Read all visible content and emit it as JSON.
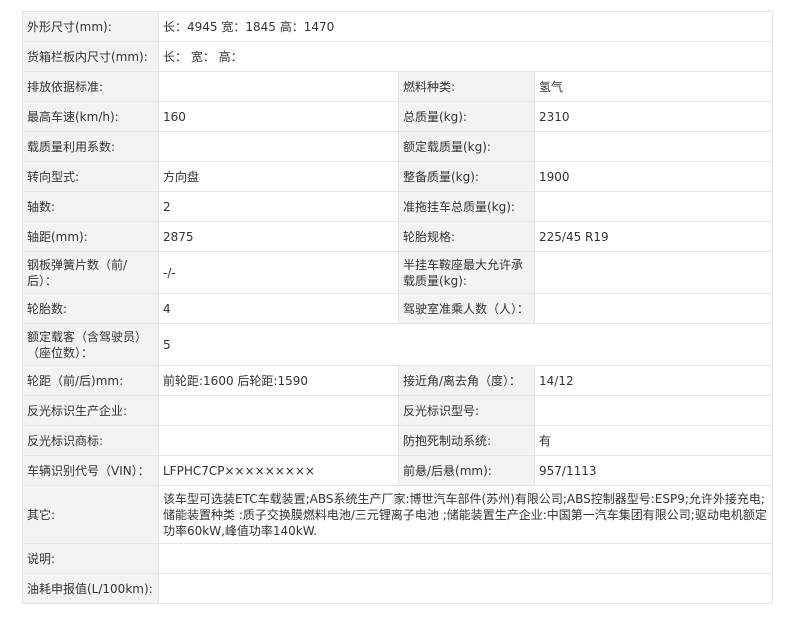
{
  "rows": [
    {
      "l1": "外形尺寸(mm):",
      "v1": "长：4945 宽：1845 高：1470"
    },
    {
      "l1": "货箱栏板内尺寸(mm):",
      "v1": "长： 宽： 高："
    },
    {
      "l1": "排放依据标准:",
      "v1": "",
      "l2": "燃料种类:",
      "v2": "氢气"
    },
    {
      "l1": "最高车速(km/h):",
      "v1": "160",
      "l2": "总质量(kg):",
      "v2": "2310"
    },
    {
      "l1": "载质量利用系数:",
      "v1": "",
      "l2": "额定载质量(kg):",
      "v2": ""
    },
    {
      "l1": "转向型式:",
      "v1": "方向盘",
      "l2": "整备质量(kg):",
      "v2": "1900"
    },
    {
      "l1": "轴数:",
      "v1": "2",
      "l2": "准拖挂车总质量(kg):",
      "v2": ""
    },
    {
      "l1": "轴距(mm):",
      "v1": "2875",
      "l2": "轮胎规格:",
      "v2": "225/45 R19"
    },
    {
      "l1": "钢板弹簧片数（前/后）：",
      "v1": "-/-",
      "l2": "半挂车鞍座最大允许承载质量(kg):",
      "v2": ""
    },
    {
      "l1": "轮胎数:",
      "v1": "4",
      "l2": "驾驶室准乘人数（人）：",
      "v2": ""
    },
    {
      "l1": "额定载客（含驾驶员）（座位数）：",
      "v1": "5"
    },
    {
      "l1": "轮距（前/后)mm:",
      "v1": "前轮距:1600 后轮距:1590",
      "l2": "接近角/离去角（度）：",
      "v2": "14/12"
    },
    {
      "l1": "反光标识生产企业:",
      "v1": "",
      "l2": "反光标识型号:",
      "v2": ""
    },
    {
      "l1": "反光标识商标:",
      "v1": "",
      "l2": "防抱死制动系统:",
      "v2": "有"
    },
    {
      "l1": "车辆识别代号（VIN）：",
      "v1": "LFPHC7CP×××××××××",
      "l2": "前悬/后悬(mm):",
      "v2": "957/1113"
    },
    {
      "l1": "其它:",
      "v1": "该车型可选装ETC车载装置;ABS系统生产厂家:博世汽车部件(苏州)有限公司;ABS控制器型号:ESP9;允许外接充电;储能装置种类 :质子交换膜燃料电池/三元锂离子电池 ;储能装置生产企业:中国第一汽车集团有限公司;驱动电机额定功率60kW,峰值功率140kW."
    },
    {
      "l1": "说明:",
      "v1": ""
    },
    {
      "l1": "油耗申报值(L/100km):",
      "v1": ""
    }
  ]
}
